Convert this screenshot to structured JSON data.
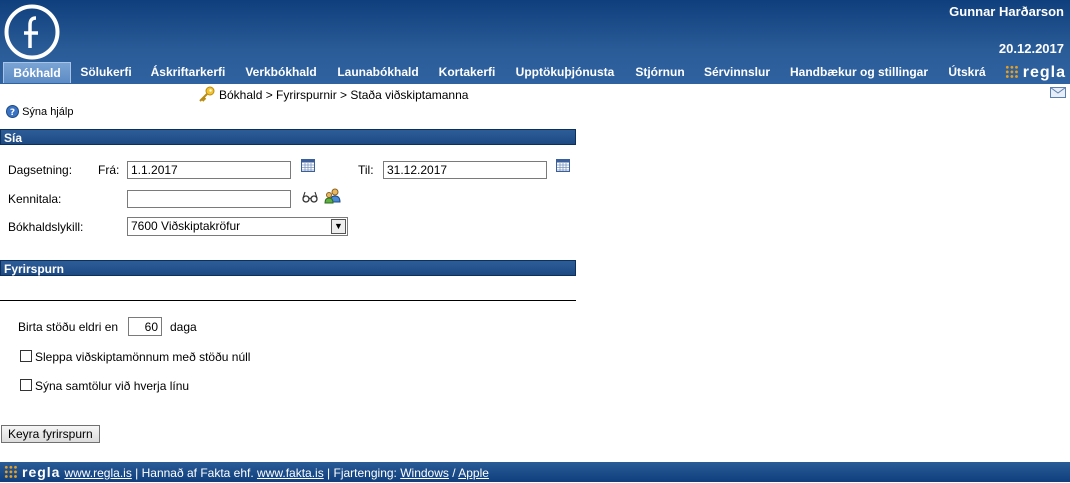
{
  "header": {
    "user_name": "Gunnar Harðarson",
    "date": "20.12.2017",
    "brand": "regla",
    "nav": [
      {
        "label": "Bókhald",
        "active": true
      },
      {
        "label": "Sölukerfi"
      },
      {
        "label": "Áskriftarkerfi"
      },
      {
        "label": "Verkbókhald"
      },
      {
        "label": "Launabókhald"
      },
      {
        "label": "Kortakerfi"
      },
      {
        "label": "Upptökuþjónusta"
      },
      {
        "label": "Stjórnun"
      },
      {
        "label": "Sérvinnslur"
      },
      {
        "label": "Handbækur og stillingar"
      },
      {
        "label": "Útskrá"
      }
    ]
  },
  "breadcrumb": "Bókhald > Fyrirspurnir > Staða viðskiptamanna",
  "help_link": "Sýna hjálp",
  "filter": {
    "title": "Sía",
    "date_label": "Dagsetning:",
    "from_label": "Frá:",
    "from_value": "1.1.2017",
    "to_label": "Til:",
    "to_value": "31.12.2017",
    "kennitala_label": "Kennitala:",
    "kennitala_value": "",
    "account_label": "Bókhaldslykill:",
    "account_value": "7600 Viðskiptakröfur"
  },
  "query": {
    "title": "Fyrirspurn",
    "older_prefix": "Birta stöðu eldri en",
    "older_value": "60",
    "older_suffix": "daga",
    "skip_zero_label": "Sleppa viðskiptamönnum með stöðu núll",
    "show_totals_label": "Sýna samtölur við hverja línu",
    "run_button": "Keyra fyrirspurn"
  },
  "footer": {
    "brand": "regla",
    "link1": "www.regla.is",
    "sep1": " | Hannað af Fakta ehf. ",
    "link2": "www.fakta.is",
    "sep2": " | Fjartenging: ",
    "link3": "Windows",
    "sep3": " / ",
    "link4": "Apple"
  },
  "colors": {
    "header_blue": "#1d4a83",
    "accent_orange": "#e8a020"
  }
}
